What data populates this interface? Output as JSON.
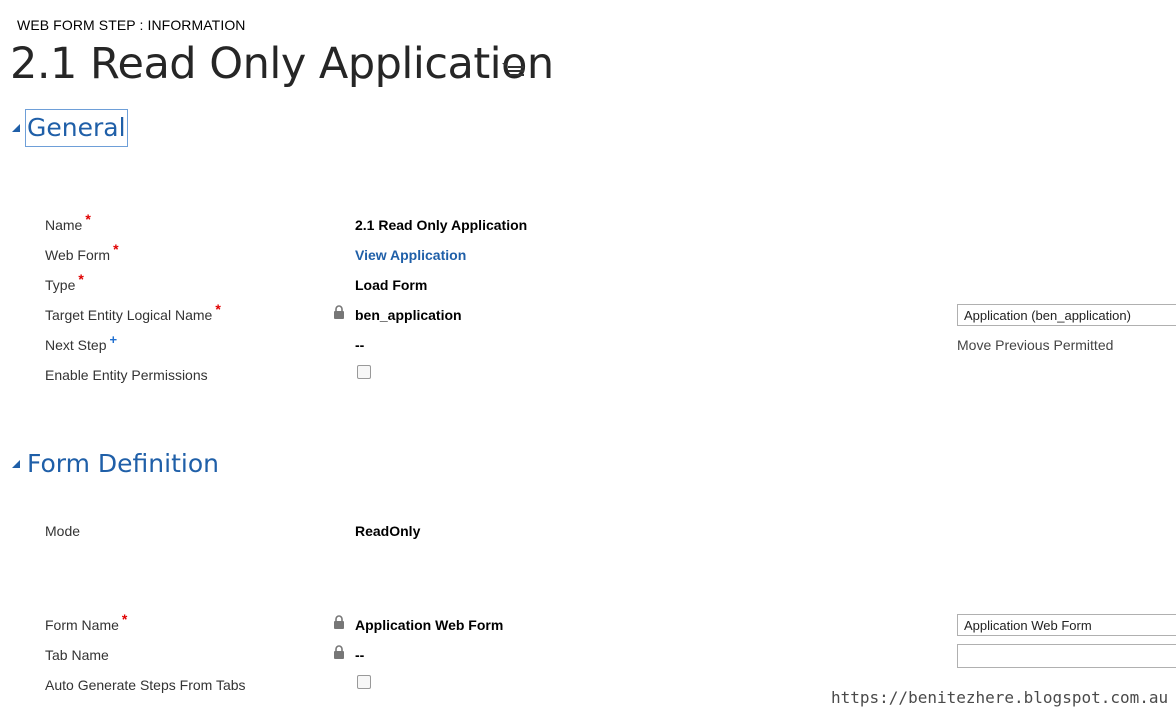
{
  "header": {
    "entity_label": "WEB FORM STEP : INFORMATION",
    "record_title": "2.1 Read Only Application"
  },
  "sections": {
    "general": {
      "title": "General",
      "fields": {
        "name": {
          "label": "Name",
          "value": "2.1 Read Only Application"
        },
        "web_form": {
          "label": "Web Form",
          "value": "View Application"
        },
        "type": {
          "label": "Type",
          "value": "Load Form"
        },
        "target_entity": {
          "label": "Target Entity Logical Name",
          "value": "ben_application",
          "side_value": "Application (ben_application)"
        },
        "next_step": {
          "label": "Next Step",
          "value": "--",
          "side_label": "Move Previous Permitted"
        },
        "enable_permissions": {
          "label": "Enable Entity Permissions",
          "checked": false
        }
      }
    },
    "form_definition": {
      "title": "Form Definition",
      "fields": {
        "mode": {
          "label": "Mode",
          "value": "ReadOnly"
        },
        "form_name": {
          "label": "Form Name",
          "value": "Application Web Form",
          "side_value": "Application Web Form"
        },
        "tab_name": {
          "label": "Tab Name",
          "value": "--",
          "side_value": ""
        },
        "auto_generate": {
          "label": "Auto Generate Steps From Tabs",
          "checked": false
        }
      }
    }
  },
  "symbols": {
    "required": "*",
    "recommended": "+"
  },
  "watermark": "https://benitezhere.blogspot.com.au",
  "colors": {
    "section_title": "#1f5fa8",
    "required": "#e00000",
    "link": "#1f5fa8"
  },
  "icons": [
    "list-menu-icon",
    "collapse-triangle-icon",
    "lock-icon"
  ]
}
